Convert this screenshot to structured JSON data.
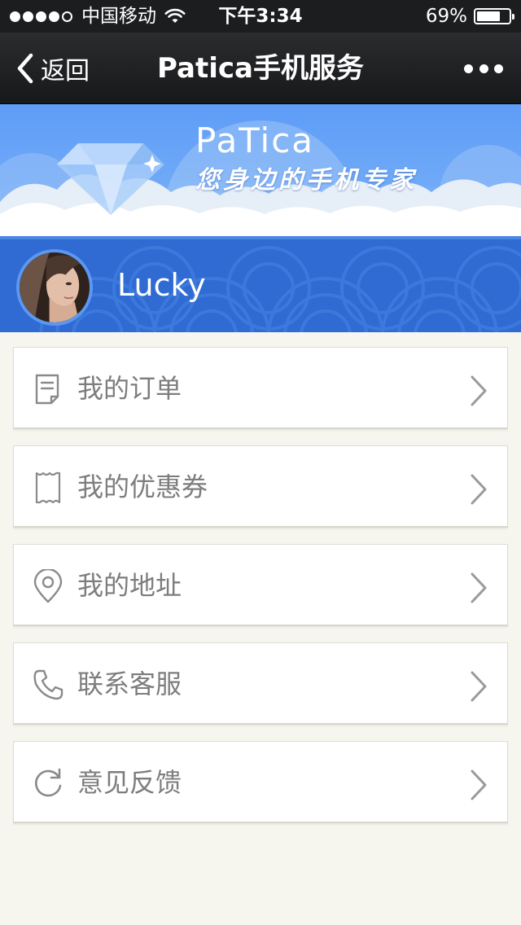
{
  "status_bar": {
    "carrier": "中国移动",
    "time": "下午3:34",
    "battery": "69%"
  },
  "nav": {
    "back_label": "返回",
    "title": "Patica手机服务"
  },
  "banner": {
    "logo": "PaTica",
    "slogan": "您身边的手机专家"
  },
  "user": {
    "name": "Lucky"
  },
  "menu": {
    "items": [
      {
        "label": "我的订单",
        "icon": "order-document-icon"
      },
      {
        "label": "我的优惠券",
        "icon": "coupon-ticket-icon"
      },
      {
        "label": "我的地址",
        "icon": "location-pin-icon"
      },
      {
        "label": "联系客服",
        "icon": "phone-icon"
      },
      {
        "label": "意见反馈",
        "icon": "refresh-feedback-icon"
      }
    ]
  },
  "colors": {
    "nav_bg": "#1c1d1f",
    "banner_blue": "#5e9cf7",
    "user_bar_blue": "#2f6bd2",
    "page_bg": "#f7f6ee",
    "menu_text": "#7d7d7d"
  }
}
